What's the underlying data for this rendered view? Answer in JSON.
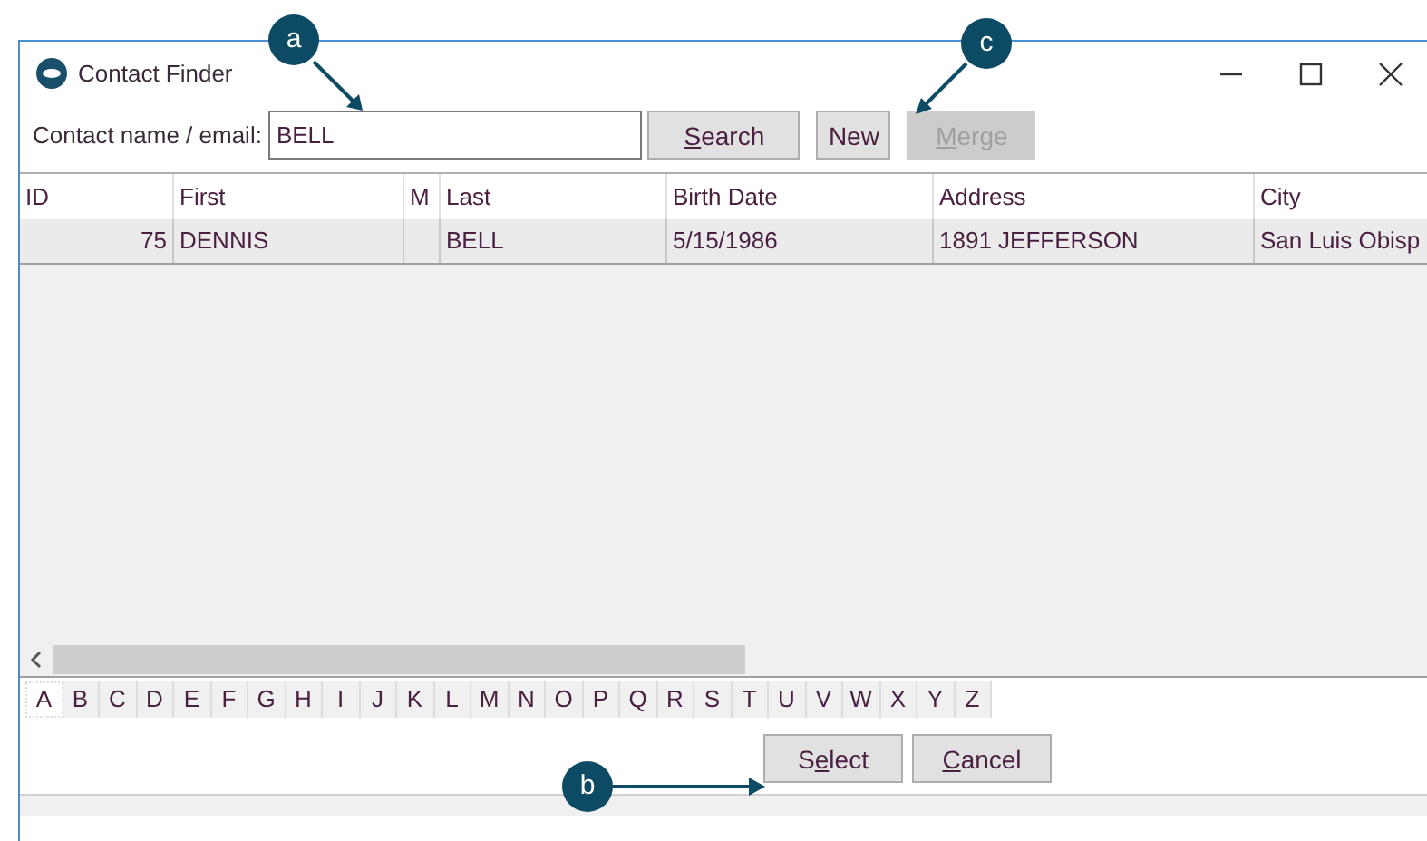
{
  "window": {
    "title": "Contact Finder"
  },
  "search": {
    "label": "Contact name / email:",
    "value": "BELL"
  },
  "toolbar_buttons": [
    {
      "key": "S",
      "after": "earch",
      "disabled": false
    },
    {
      "before": "New",
      "disabled": false
    },
    {
      "key": "M",
      "after": "erge",
      "disabled": true
    }
  ],
  "table": {
    "columns": [
      "ID",
      "First",
      "M",
      "Last",
      "Birth Date",
      "Address",
      "City"
    ],
    "rows": [
      {
        "cells": [
          "75",
          "DENNIS",
          "",
          "BELL",
          "5/15/1986",
          "1891 JEFFERSON",
          "San Luis Obisp"
        ],
        "selected": true
      }
    ]
  },
  "letters": [
    {
      "label": "A",
      "selected": true
    },
    {
      "label": "B",
      "selected": false
    },
    {
      "label": "C",
      "selected": false
    },
    {
      "label": "D",
      "selected": false
    },
    {
      "label": "E",
      "selected": false
    },
    {
      "label": "F",
      "selected": false
    },
    {
      "label": "G",
      "selected": false
    },
    {
      "label": "H",
      "selected": false
    },
    {
      "label": "I",
      "selected": false
    },
    {
      "label": "J",
      "selected": false
    },
    {
      "label": "K",
      "selected": false
    },
    {
      "label": "L",
      "selected": false
    },
    {
      "label": "M",
      "selected": false
    },
    {
      "label": "N",
      "selected": false
    },
    {
      "label": "O",
      "selected": false
    },
    {
      "label": "P",
      "selected": false
    },
    {
      "label": "Q",
      "selected": false
    },
    {
      "label": "R",
      "selected": false
    },
    {
      "label": "S",
      "selected": false
    },
    {
      "label": "T",
      "selected": false
    },
    {
      "label": "U",
      "selected": false
    },
    {
      "label": "V",
      "selected": false
    },
    {
      "label": "W",
      "selected": false
    },
    {
      "label": "X",
      "selected": false
    },
    {
      "label": "Y",
      "selected": false
    },
    {
      "label": "Z",
      "selected": false
    }
  ],
  "footer_buttons": [
    {
      "before": "S",
      "key": "e",
      "after": "lect",
      "disabled": false
    },
    {
      "key": "C",
      "after": "ancel",
      "disabled": false
    }
  ],
  "callouts": [
    {
      "label": "a"
    },
    {
      "label": "b"
    },
    {
      "label": "c"
    }
  ]
}
